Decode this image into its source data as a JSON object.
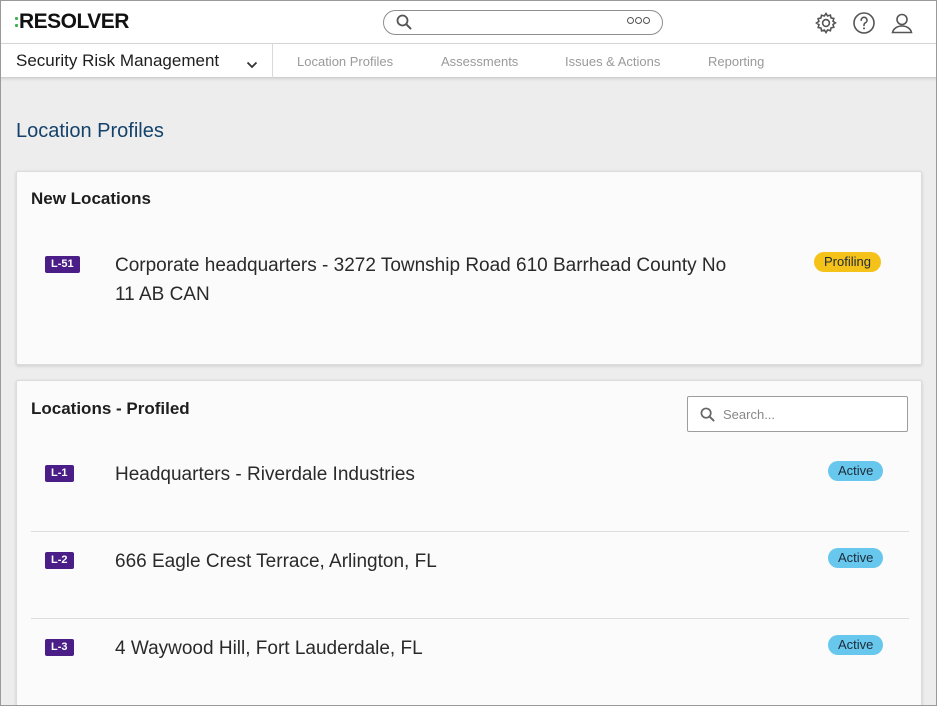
{
  "header": {
    "logo_text": "RESOLVER",
    "icons": [
      "search-icon",
      "more-options-icon",
      "gear-icon",
      "help-icon",
      "user-icon"
    ]
  },
  "app_nav": {
    "app_name": "Security Risk Management",
    "tabs": [
      {
        "label": "Location Profiles"
      },
      {
        "label": "Assessments"
      },
      {
        "label": "Issues & Actions"
      },
      {
        "label": "Reporting"
      }
    ]
  },
  "page": {
    "title": "Location Profiles",
    "new_locations": {
      "title": "New Locations",
      "items": [
        {
          "id": "L-51",
          "line1": "Corporate headquarters - 3272 Township Road 610 Barrhead County No",
          "line2": "11 AB CAN",
          "status": "Profiling"
        }
      ]
    },
    "profiled": {
      "title": "Locations - Profiled",
      "search_placeholder": "Search...",
      "items": [
        {
          "id": "L-1",
          "name": "Headquarters - Riverdale Industries",
          "status": "Active"
        },
        {
          "id": "L-2",
          "name": "666 Eagle Crest Terrace, Arlington, FL",
          "status": "Active"
        },
        {
          "id": "L-3",
          "name": "4 Waywood Hill, Fort Lauderdale, FL",
          "status": "Active"
        }
      ]
    }
  },
  "colors": {
    "accent_title": "#14426b",
    "id_badge": "#4a1d87",
    "status_profiling": "#f5c21a",
    "status_active": "#67c7ec",
    "logo_dots": "#3bb34a"
  }
}
